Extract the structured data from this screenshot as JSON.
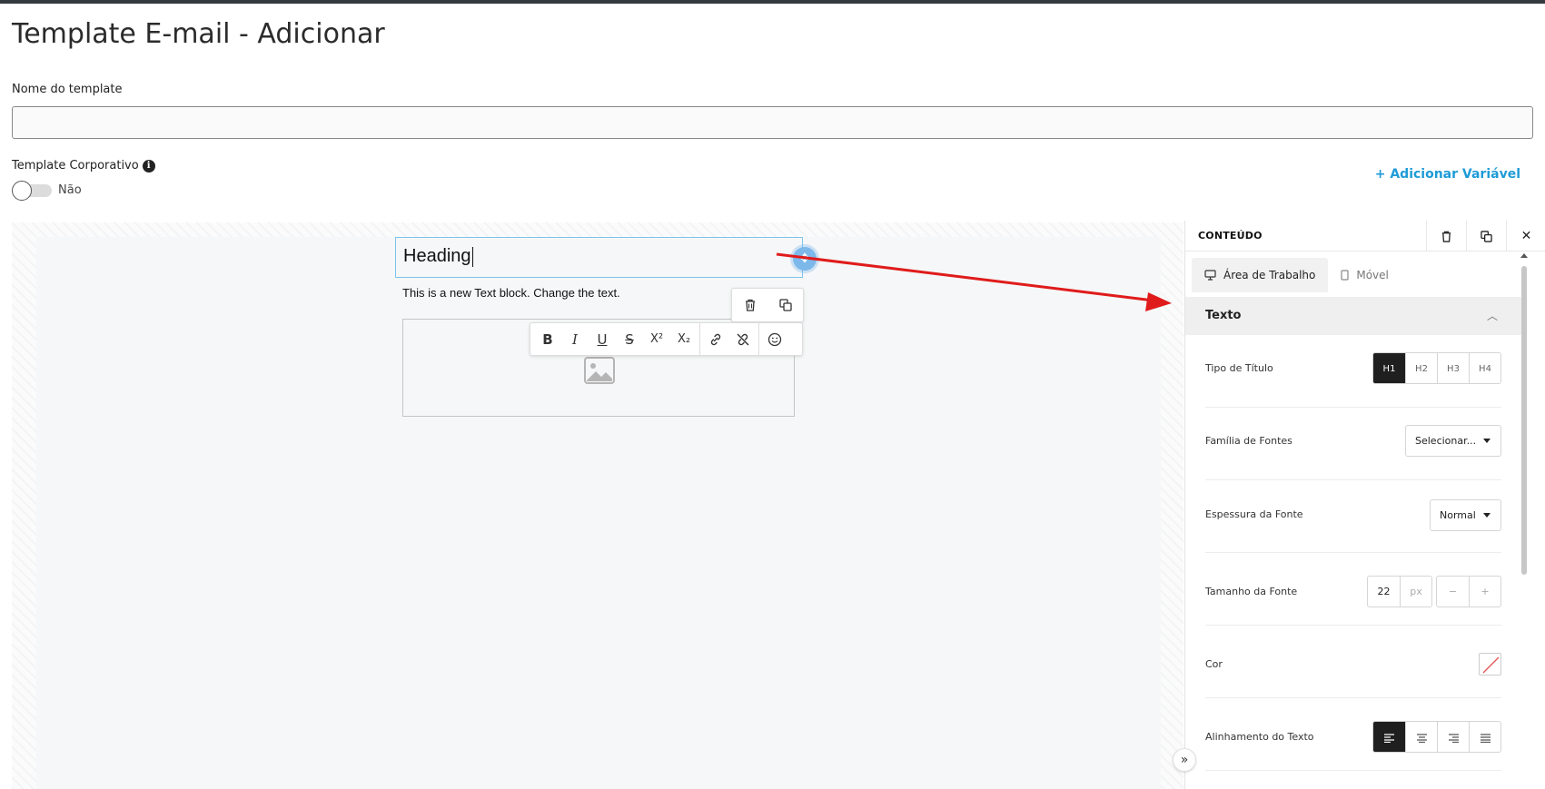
{
  "page": {
    "title": "Template E-mail - Adicionar"
  },
  "form": {
    "name_label": "Nome do template",
    "name_value": "",
    "corporate_label": "Template Corporativo",
    "corporate_toggle_text": "Não",
    "add_variable": "+ Adicionar Variável"
  },
  "canvas": {
    "heading_text": "Heading",
    "text_block": "This is a new Text block. Change the text."
  },
  "toolbar": {
    "buttons": [
      "B",
      "I",
      "U",
      "S",
      "X²",
      "X₂"
    ]
  },
  "panel": {
    "title": "CONTEÚDO",
    "tabs": [
      "Área de Trabalho",
      "Móvel"
    ],
    "section_title": "Texto",
    "rows": {
      "heading_type": {
        "label": "Tipo de Título",
        "options": [
          "H1",
          "H2",
          "H3",
          "H4"
        ],
        "selected": "H1"
      },
      "font_family": {
        "label": "Família de Fontes",
        "value": "Selecionar..."
      },
      "font_weight": {
        "label": "Espessura da Fonte",
        "value": "Normal"
      },
      "font_size": {
        "label": "Tamanho da Fonte",
        "value": "22",
        "unit": "px",
        "minus": "−",
        "plus": "+"
      },
      "color": {
        "label": "Cor"
      },
      "text_align": {
        "label": "Alinhamento do Texto",
        "selected": "left"
      }
    }
  },
  "colors": {
    "accent_link": "#1e9bd7",
    "selection_border": "#7cc3ef",
    "segment_active": "#1f1f1f",
    "annotation_arrow": "#e01b1b"
  }
}
